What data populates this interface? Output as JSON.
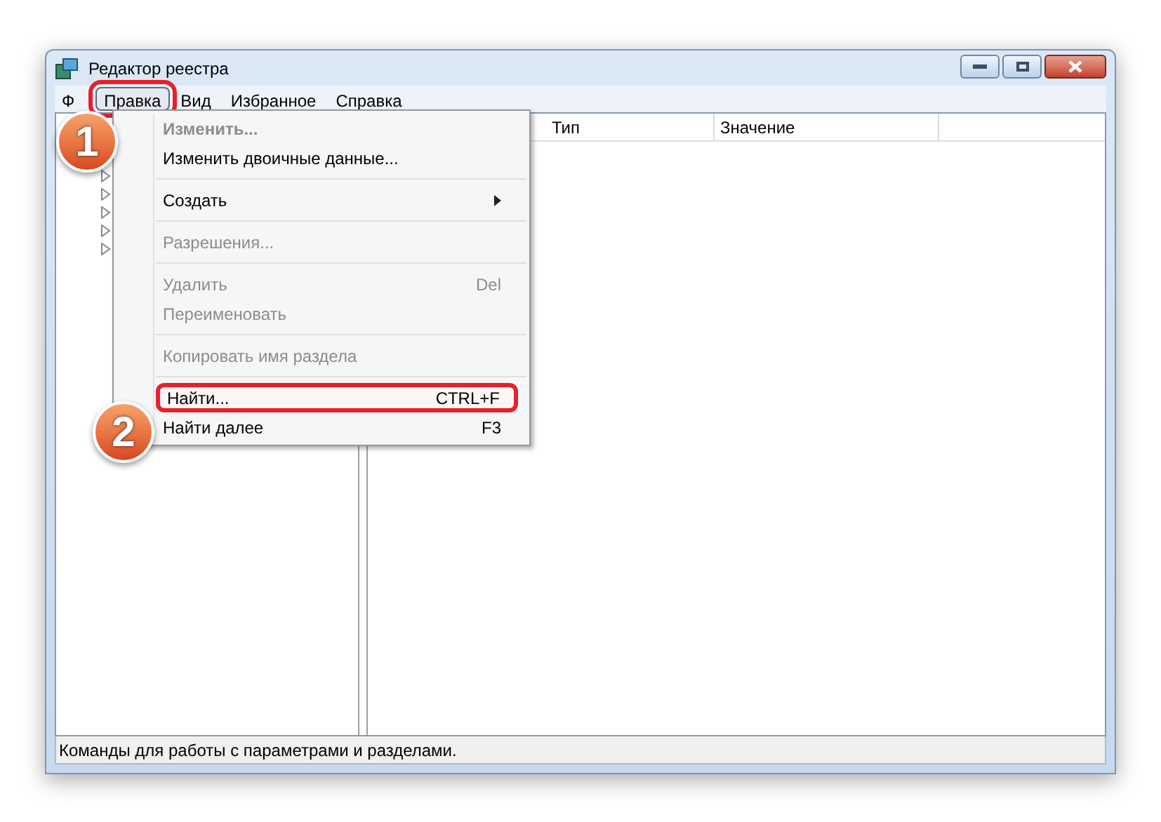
{
  "window": {
    "title": "Редактор реестра"
  },
  "menu_bar": [
    {
      "label": "Ф",
      "selected": false,
      "highlighted": false
    },
    {
      "label": "Правка",
      "selected": true,
      "highlighted": true
    },
    {
      "label": "Вид",
      "selected": false,
      "highlighted": false
    },
    {
      "label": "Избранное",
      "selected": false,
      "highlighted": false
    },
    {
      "label": "Справка",
      "selected": false,
      "highlighted": false
    }
  ],
  "tree": {
    "items": [
      {
        "expanded": false
      },
      {
        "expanded": false
      },
      {
        "expanded": false
      },
      {
        "expanded": false
      },
      {
        "expanded": false
      }
    ]
  },
  "list": {
    "columns": [
      "Тип",
      "Значение"
    ]
  },
  "dropdown_menu": [
    {
      "kind": "item",
      "label": "Изменить...",
      "disabled": true,
      "default": true,
      "submenu": false,
      "highlighted": false
    },
    {
      "kind": "item",
      "label": "Изменить двоичные данные...",
      "disabled": false,
      "default": false,
      "submenu": false,
      "highlighted": false
    },
    {
      "kind": "separator"
    },
    {
      "kind": "item",
      "label": "Создать",
      "disabled": false,
      "default": false,
      "submenu": true,
      "highlighted": false
    },
    {
      "kind": "separator"
    },
    {
      "kind": "item",
      "label": "Разрешения...",
      "disabled": true,
      "default": false,
      "submenu": false,
      "highlighted": false
    },
    {
      "kind": "separator"
    },
    {
      "kind": "item",
      "label": "Удалить",
      "shortcut": "Del",
      "disabled": true,
      "default": false,
      "submenu": false,
      "highlighted": false
    },
    {
      "kind": "item",
      "label": "Переименовать",
      "disabled": true,
      "default": false,
      "submenu": false,
      "highlighted": false
    },
    {
      "kind": "separator"
    },
    {
      "kind": "item",
      "label": "Копировать имя раздела",
      "disabled": true,
      "default": false,
      "submenu": false,
      "highlighted": false
    },
    {
      "kind": "separator"
    },
    {
      "kind": "item",
      "label": "Найти...",
      "shortcut": "CTRL+F",
      "disabled": false,
      "default": false,
      "submenu": false,
      "highlighted": true
    },
    {
      "kind": "item",
      "label": "Найти далее",
      "shortcut": "F3",
      "disabled": false,
      "default": false,
      "submenu": false,
      "highlighted": false
    }
  ],
  "callouts": [
    {
      "number": "1"
    },
    {
      "number": "2"
    }
  ],
  "status_bar": "Команды для работы с параметрами и разделами."
}
